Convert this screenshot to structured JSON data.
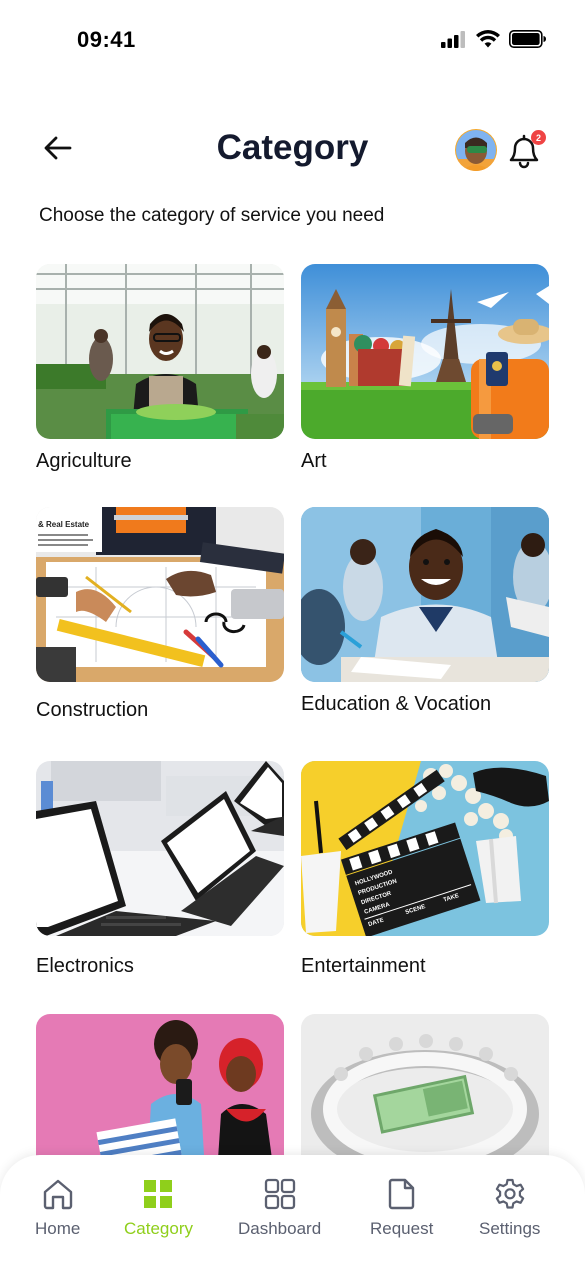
{
  "status_bar": {
    "time": "09:41"
  },
  "header": {
    "title": "Category",
    "notification_count": "2"
  },
  "subtitle": "Choose the category of service you need",
  "categories": [
    {
      "label": "Agriculture"
    },
    {
      "label": "Art"
    },
    {
      "label": "Construction"
    },
    {
      "label": "Education & Vocation"
    },
    {
      "label": "Electronics"
    },
    {
      "label": "Entertainment"
    },
    {
      "label": ""
    },
    {
      "label": ""
    }
  ],
  "thumb_texts": {
    "construction_doc_title": "& Real Estate",
    "clapper_lines": [
      "HOLLYWOOD",
      "PRODUCTION",
      "DIRECTOR",
      "CAMERA",
      "DATE",
      "SCENE",
      "TAKE"
    ]
  },
  "tabbar": {
    "home": "Home",
    "category": "Category",
    "dashboard": "Dashboard",
    "request": "Request",
    "settings": "Settings"
  },
  "colors": {
    "accent": "#8fcf1b",
    "title": "#141a2e",
    "badge": "#ef4444",
    "tab_inactive": "#5b6070"
  }
}
